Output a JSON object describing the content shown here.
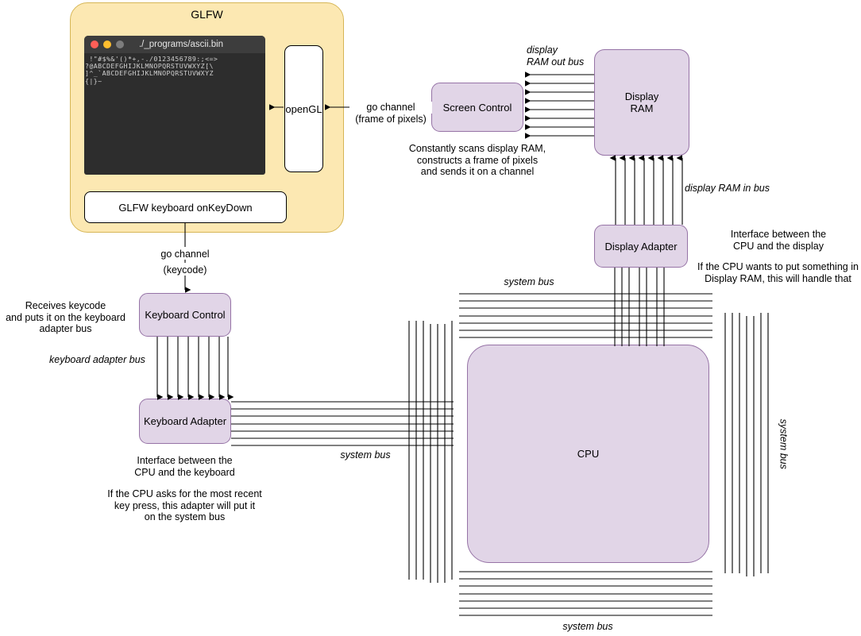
{
  "diagram": {
    "title": "Computer architecture: GLFW display and keyboard, CPU and system bus",
    "colors": {
      "glfw_container_fill": "#fce8b2",
      "glfw_container_stroke": "#d6b656",
      "component_fill": "#e1d5e7",
      "component_stroke": "#9673a6",
      "white_box_fill": "#ffffff",
      "line": "#000000",
      "terminal_bg": "#2d2d2d",
      "terminal_titlebar": "#3d3d3d",
      "terminal_text": "#cfcfcf",
      "dot_red": "#ff5f57",
      "dot_yellow": "#ffbd2e",
      "dot_gray": "#7d7d7d"
    }
  },
  "glfw": {
    "title": "GLFW",
    "opengl_label": "openGL",
    "keyboard_callback_label": "GLFW keyboard onKeyDown"
  },
  "terminal": {
    "title": "./_programs/ascii.bin",
    "dots": [
      "close-dot",
      "minimize-dot",
      "maximize-dot"
    ],
    "lines": [
      " !\"#$%&'()*+,-./0123456789:;<=>",
      "?@ABCDEFGHIJKLMNOPQRSTUVWXYZ[\\",
      "]^_`ABCDEFGHIJKLMNOPQRSTUVWXYZ",
      "{|}~"
    ]
  },
  "components": {
    "screen_control": "Screen Control",
    "display_ram": "Display\nRAM",
    "display_ram_line1": "Display",
    "display_ram_line2": "RAM",
    "display_adapter": "Display Adapter",
    "keyboard_control": "Keyboard Control",
    "keyboard_adapter": "Keyboard Adapter",
    "cpu": "CPU"
  },
  "labels": {
    "go_channel_pixels_line1": "go channel",
    "go_channel_pixels_line2": "(frame of pixels)",
    "go_channel_keycode_line1": "go channel",
    "go_channel_keycode_line2": "(keycode)",
    "display_ram_out_bus_line1": "display",
    "display_ram_out_bus_line2": "RAM out bus",
    "display_ram_in_bus": "display RAM in bus",
    "keyboard_adapter_bus": "keyboard adapter bus",
    "system_bus_top": "system bus",
    "system_bus_left": "system bus",
    "system_bus_right": "system bus",
    "system_bus_bottom": "system bus"
  },
  "notes": {
    "screen_control": "Constantly scans display RAM,\nconstructs a frame of pixels\nand sends it on a channel",
    "screen_control_l1": "Constantly scans display RAM,",
    "screen_control_l2": "constructs a frame of pixels",
    "screen_control_l3": "and sends it on a channel",
    "display_adapter_a_l1": "Interface between the",
    "display_adapter_a_l2": "CPU and the display",
    "display_adapter_b_l1": "If the CPU wants to put something in",
    "display_adapter_b_l2": "Display RAM, this will handle that",
    "keyboard_control_l1": "Receives keycode",
    "keyboard_control_l2": "and puts it on the keyboard",
    "keyboard_control_l3": "adapter bus",
    "keyboard_adapter_a_l1": "Interface between the",
    "keyboard_adapter_a_l2": "CPU and the keyboard",
    "keyboard_adapter_b_l1": "If the CPU asks for the most recent",
    "keyboard_adapter_b_l2": "key press, this adapter will put it",
    "keyboard_adapter_b_l3": "on the system bus"
  },
  "buses": {
    "display_ram_out_wire_count": 8,
    "display_ram_in_wire_count": 8,
    "keyboard_adapter_wire_count": 8,
    "system_bus_top_wire_count": 7,
    "system_bus_bottom_wire_count": 7,
    "system_bus_left_wire_count": 7,
    "system_bus_right_wire_count": 7,
    "keyboard_adapter_out_wire_count": 7,
    "display_adapter_down_wire_count": 7
  }
}
